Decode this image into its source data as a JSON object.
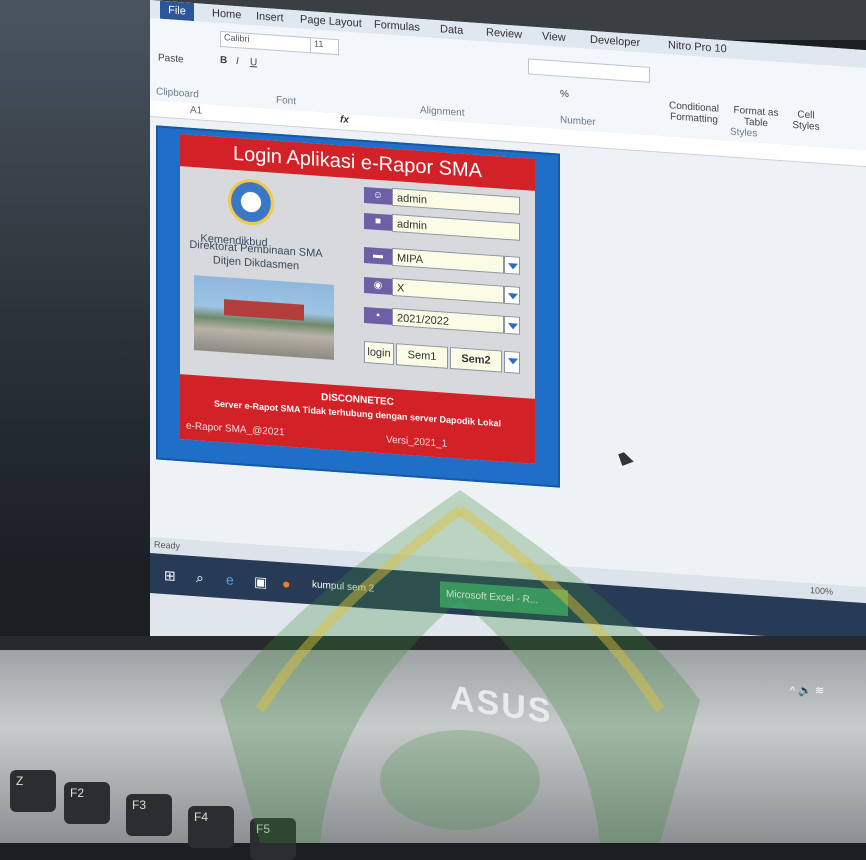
{
  "ribbon": {
    "tabs": [
      "File",
      "Home",
      "Insert",
      "Page Layout",
      "Formulas",
      "Data",
      "Review",
      "View",
      "Developer",
      "Nitro Pro 10"
    ],
    "font_name": "Calibri",
    "font_size": "11",
    "groups": [
      "Clipboard",
      "Font",
      "Alignment",
      "Number",
      "Styles"
    ],
    "paste_label": "Paste",
    "buttons": [
      "Conditional Formatting",
      "Format as Table",
      "Cell Styles"
    ],
    "number_format": "%",
    "name_box": "A1",
    "fx": "fx"
  },
  "dialog": {
    "title": "Login Aplikasi e-Rapor SMA",
    "org_line1": "Direktorat Pembinaan SMA",
    "org_line2": "Ditjen Dikdasmen",
    "org_line3": "Kemendikbud",
    "username": "admin",
    "password": "admin",
    "jurusan": "MIPA",
    "kelas": "X",
    "tahun": "2021/2022",
    "login_label": "login",
    "sem1": "Sem1",
    "sem2": "Sem2",
    "status_title": "DISCONNETEC",
    "status_msg": "Server e-Rapot SMA Tidak terhubung dengan server Dapodik Lokal",
    "footer_left": "e-Rapor SMA_@2021",
    "footer_right": "Versi_2021_1"
  },
  "status_bar": {
    "ready": "Ready"
  },
  "taskbar": {
    "items": [
      "kumpul sem 2",
      "Microsoft Excel - R..."
    ],
    "zoom": "100%"
  },
  "laptop": {
    "brand": "ASUS"
  },
  "keys": [
    "Z",
    "F2",
    "F3",
    "F4",
    "F5"
  ]
}
